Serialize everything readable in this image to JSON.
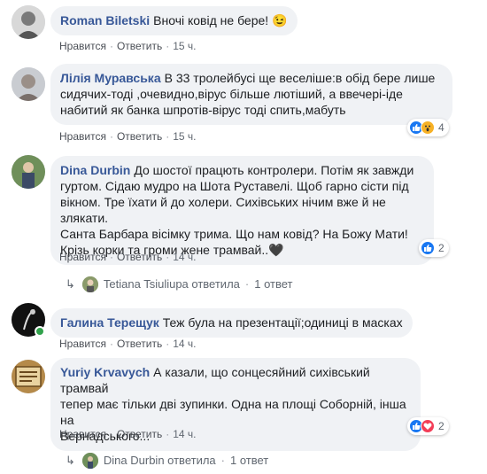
{
  "actions": {
    "like": "Нравится",
    "reply": "Ответить",
    "sep": "·"
  },
  "comments": [
    {
      "author": "Roman Biletski",
      "text": "Вночі ковід не бере! 😉",
      "time": "15 ч."
    },
    {
      "author": "Лілія Муравська",
      "lines": [
        "В 33 тролейбусі ще веселіше:в обід бере лише",
        "сидячих-тоді ,очевидно,вірус більше лютіший, а ввечері-іде",
        "набитий як банка шпротів-вірус тоді спить,мабуть"
      ],
      "time": "15 ч.",
      "reactions": {
        "icons": [
          "like-icon",
          "wow-icon"
        ],
        "count": "4"
      }
    },
    {
      "author": "Dina Durbin",
      "lines": [
        "До шостої працють контролери. Потім як завжди",
        "гуртом. Сідаю мудро на Шота Руставелі. Щоб гарно сісти під",
        "вікном. Тре їхати й до холери. Сихівських нічим вже й не злякати.",
        "Санта Барбара вісімку трима. Що нам ковід? На Божу Мати!",
        "Крізь корки та громи жене трамвай..🖤"
      ],
      "time": "14 ч.",
      "reactions": {
        "icons": [
          "like-icon"
        ],
        "count": "2"
      },
      "replies": {
        "name": "Tetiana Tsiuliupa ответила",
        "count": "1 ответ"
      }
    },
    {
      "author": "Галина Терещук",
      "text": "Теж була на презентації;одиниці в масках",
      "time": "14 ч."
    },
    {
      "author": "Yuriy Krvavych",
      "lines": [
        "А казали, що сонцесяйний сихівський трамвай",
        "тепер має тільки дві зупинки. Одна на площі Соборній, інша на",
        "Вернадського..."
      ],
      "time": "14 ч.",
      "reactions": {
        "icons": [
          "like-icon",
          "love-icon"
        ],
        "count": "2"
      },
      "replies": {
        "name": "Dina Durbin ответила",
        "count": "1 ответ"
      }
    }
  ]
}
